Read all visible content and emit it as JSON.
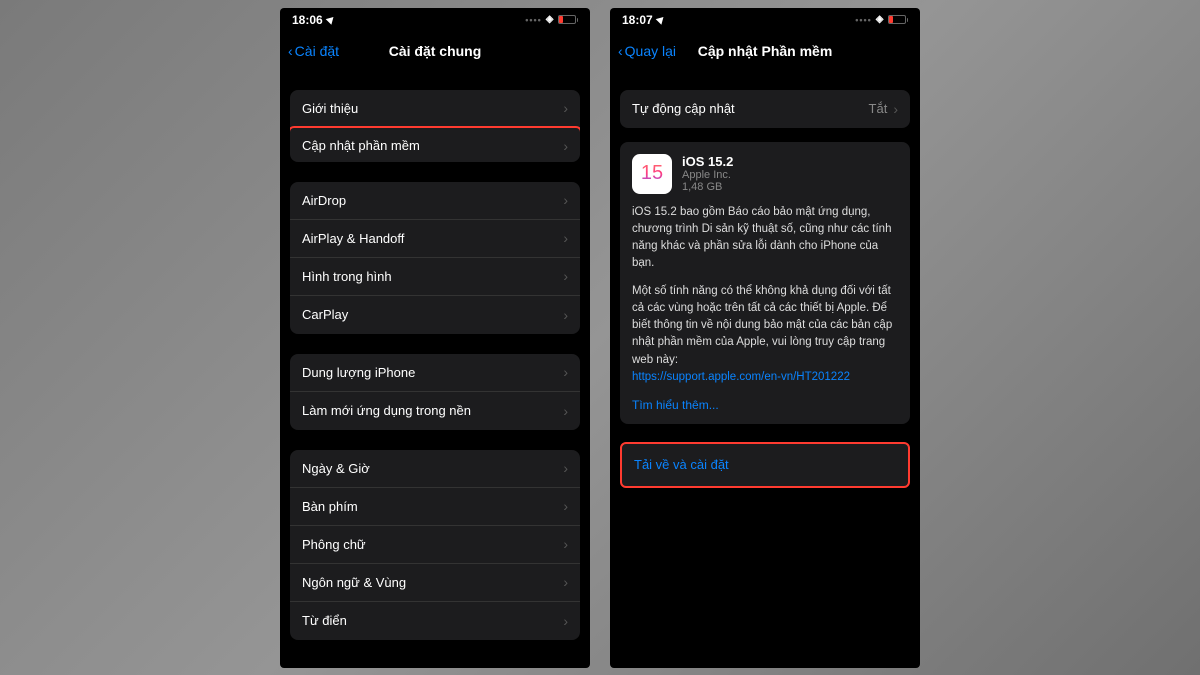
{
  "left": {
    "statusTime": "18:06",
    "backLabel": "Cài đặt",
    "navTitle": "Cài đặt chung",
    "section1": [
      {
        "label": "Giới thiệu",
        "highlighted": false
      },
      {
        "label": "Cập nhật phần mềm",
        "highlighted": true
      }
    ],
    "section2": [
      {
        "label": "AirDrop"
      },
      {
        "label": "AirPlay & Handoff"
      },
      {
        "label": "Hình trong hình"
      },
      {
        "label": "CarPlay"
      }
    ],
    "section3": [
      {
        "label": "Dung lượng iPhone"
      },
      {
        "label": "Làm mới ứng dụng trong nền"
      }
    ],
    "section4": [
      {
        "label": "Ngày & Giờ"
      },
      {
        "label": "Bàn phím"
      },
      {
        "label": "Phông chữ"
      },
      {
        "label": "Ngôn ngữ & Vùng"
      },
      {
        "label": "Từ điển"
      }
    ]
  },
  "right": {
    "statusTime": "18:07",
    "backLabel": "Quay lại",
    "navTitle": "Cập nhật Phần mềm",
    "autoUpdateLabel": "Tự động cập nhật",
    "autoUpdateValue": "Tắt",
    "update": {
      "iconText": "15",
      "title": "iOS 15.2",
      "publisher": "Apple Inc.",
      "size": "1,48 GB",
      "desc1": "iOS 15.2 bao gồm Báo cáo bảo mật ứng dụng, chương trình Di sản kỹ thuật số, cũng như các tính năng khác và phần sửa lỗi dành cho iPhone của bạn.",
      "desc2": "Một số tính năng có thể không khả dụng đối với tất cả các vùng hoặc trên tất cả các thiết bị Apple. Để biết thông tin về nội dung bảo mật của các bản cập nhật phần mềm của Apple, vui lòng truy cập trang web này:",
      "link": "https://support.apple.com/en-vn/HT201222",
      "learnMore": "Tìm hiểu thêm..."
    },
    "downloadLabel": "Tải về và cài đặt"
  }
}
